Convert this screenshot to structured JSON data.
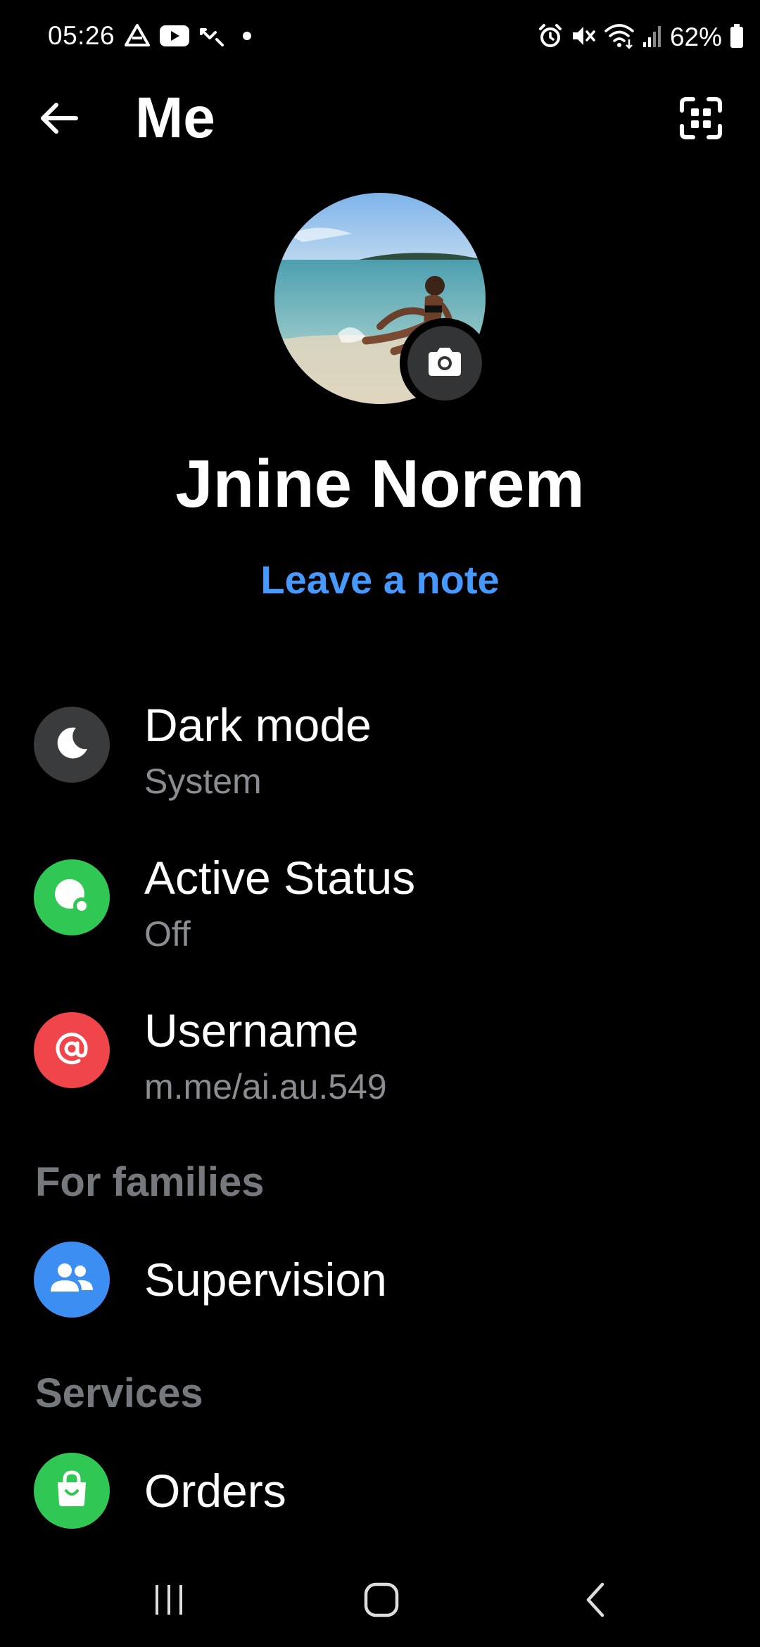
{
  "status_bar": {
    "time": "05:26",
    "battery_percent": "62%",
    "left_icons": [
      "drive-icon",
      "youtube-icon",
      "missed-call-icon",
      "dot-icon"
    ],
    "right_icons": [
      "alarm-icon",
      "mute-icon",
      "wifi-icon",
      "signal-icon",
      "battery-icon"
    ]
  },
  "app_bar": {
    "title": "Me",
    "back_icon": "arrow-left-icon",
    "qr_icon": "qr-scan-icon"
  },
  "profile": {
    "name": "Jnine Norem",
    "note_link": "Leave a note",
    "camera_icon": "camera-icon"
  },
  "settings": {
    "dark_mode": {
      "title": "Dark mode",
      "value": "System",
      "icon": "moon-icon",
      "icon_bg": "#3a3b3c"
    },
    "active_status": {
      "title": "Active Status",
      "value": "Off",
      "icon": "active-status-icon",
      "icon_bg": "#31c755"
    },
    "username": {
      "title": "Username",
      "value": "m.me/ai.au.549",
      "icon": "at-sign-icon",
      "icon_bg": "#f0454a"
    }
  },
  "families": {
    "header": "For families",
    "supervision": {
      "title": "Supervision",
      "icon": "people-icon",
      "icon_bg": "#3c8ef2"
    }
  },
  "services": {
    "header": "Services",
    "orders": {
      "title": "Orders",
      "icon": "shopping-bag-icon",
      "icon_bg": "#31c755"
    }
  },
  "nav_bar": {
    "recents_icon": "recents-icon",
    "home_icon": "home-icon",
    "back_icon": "nav-back-icon"
  },
  "colors": {
    "background": "#000000",
    "accent_link": "#4599ff",
    "secondary_text": "#8a8d91",
    "section_header": "#75787d"
  }
}
